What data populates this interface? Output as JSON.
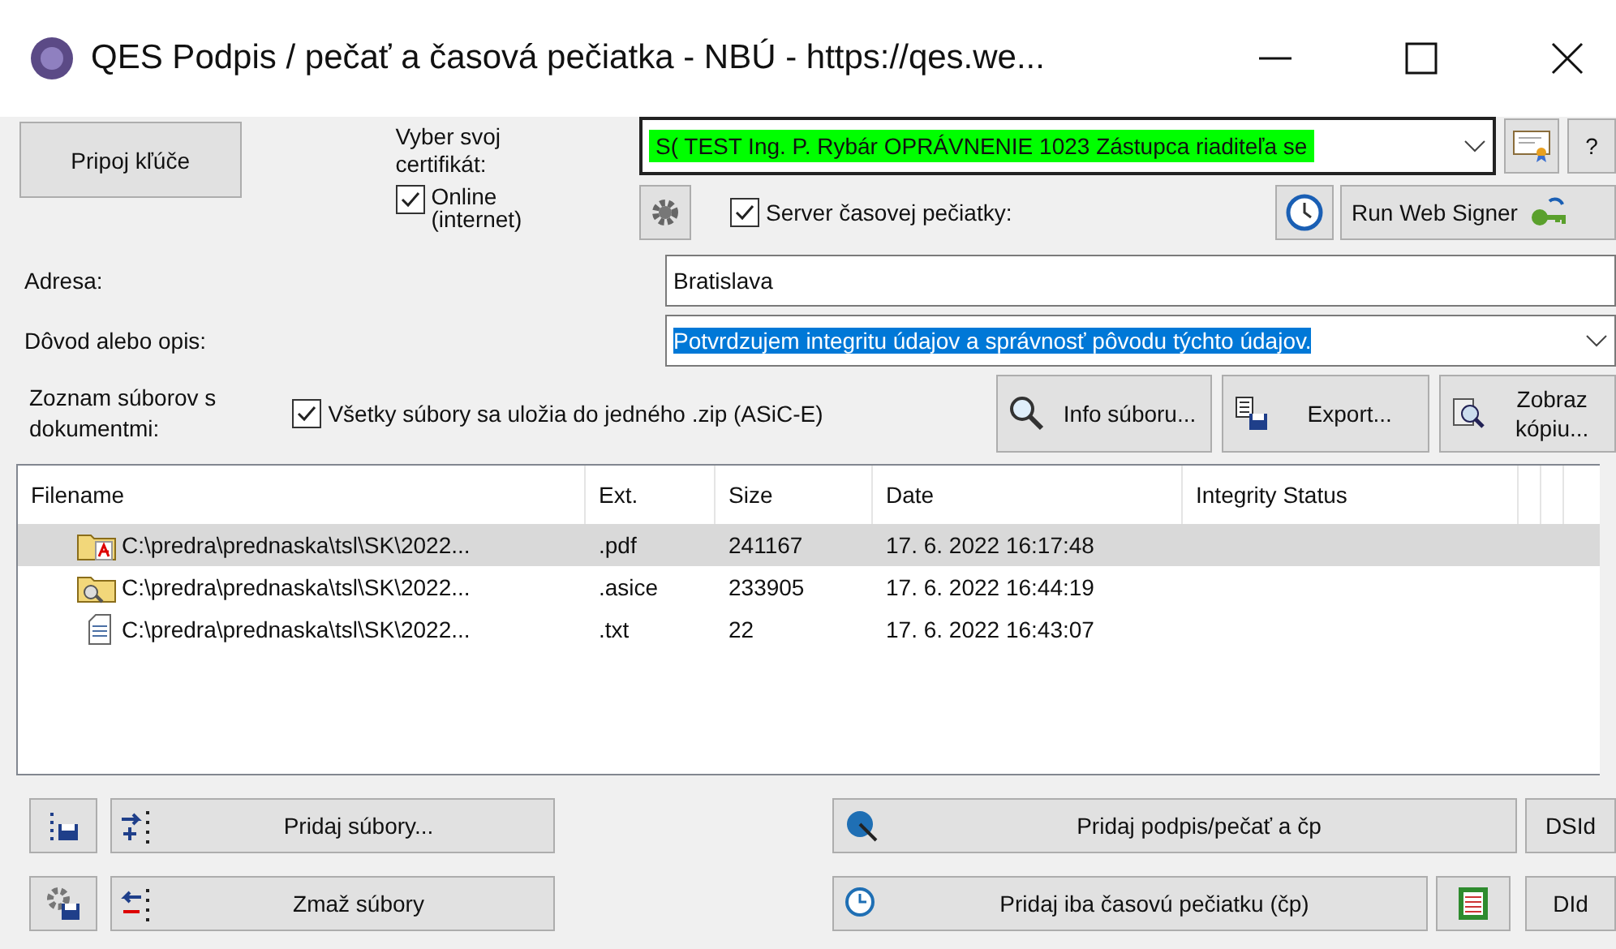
{
  "window": {
    "title": "QES Podpis / pečať a časová pečiatka - NBÚ - https://qes.we..."
  },
  "connect_button": "Pripoj kľúče",
  "certificate": {
    "label": "Vyber svoj certifikát:",
    "value": "S( TEST Ing. P. Rybár OPRÁVNENIE 1023 Zástupca riaditeľa se",
    "help_button": "?"
  },
  "online": {
    "label": "Online (internet)",
    "checked": true
  },
  "timestamp_server": {
    "label": "Server časovej pečiatky:",
    "checked": true
  },
  "run_web_signer": "Run Web Signer",
  "address": {
    "label": "Adresa:",
    "value": "Bratislava"
  },
  "reason": {
    "label": "Dôvod alebo opis:",
    "value": "Potvrdzujem integritu údajov a správnosť pôvodu týchto údajov.",
    "text_selected": true
  },
  "files": {
    "label": "Zoznam súborov s dokumentmi:",
    "zip": {
      "label": "Všetky súbory sa uložia do jedného .zip (ASiC-E)",
      "checked": true
    },
    "buttons": [
      {
        "kind": "info",
        "label": "Info súboru..."
      },
      {
        "kind": "export",
        "label": "Export..."
      },
      {
        "kind": "copy",
        "label": "Zobraz kópiu..."
      }
    ]
  },
  "table": {
    "columns": [
      "Filename",
      "Ext.",
      "Size",
      "Date",
      "Integrity Status"
    ],
    "rows": [
      {
        "kind": "pdf",
        "filename": "C:\\predra\\prednaska\\tsl\\SK\\2022...",
        "ext": ".pdf",
        "size": "241167",
        "date": "17. 6. 2022 16:17:48",
        "selected": true
      },
      {
        "kind": "asice",
        "filename": "C:\\predra\\prednaska\\tsl\\SK\\2022...",
        "ext": ".asice",
        "size": "233905",
        "date": "17. 6. 2022 16:44:19",
        "selected": false
      },
      {
        "kind": "txt",
        "filename": "C:\\predra\\prednaska\\tsl\\SK\\2022...",
        "ext": ".txt",
        "size": "22",
        "date": "17. 6. 2022 16:43:07",
        "selected": false
      }
    ]
  },
  "bottom": {
    "add_files": "Pridaj súbory...",
    "remove_files": "Zmaž súbory",
    "add_signature": "Pridaj podpis/pečať a čp",
    "add_timestamp": "Pridaj iba časovú pečiatku (čp)",
    "dsid": "DSId",
    "did": "DId"
  }
}
